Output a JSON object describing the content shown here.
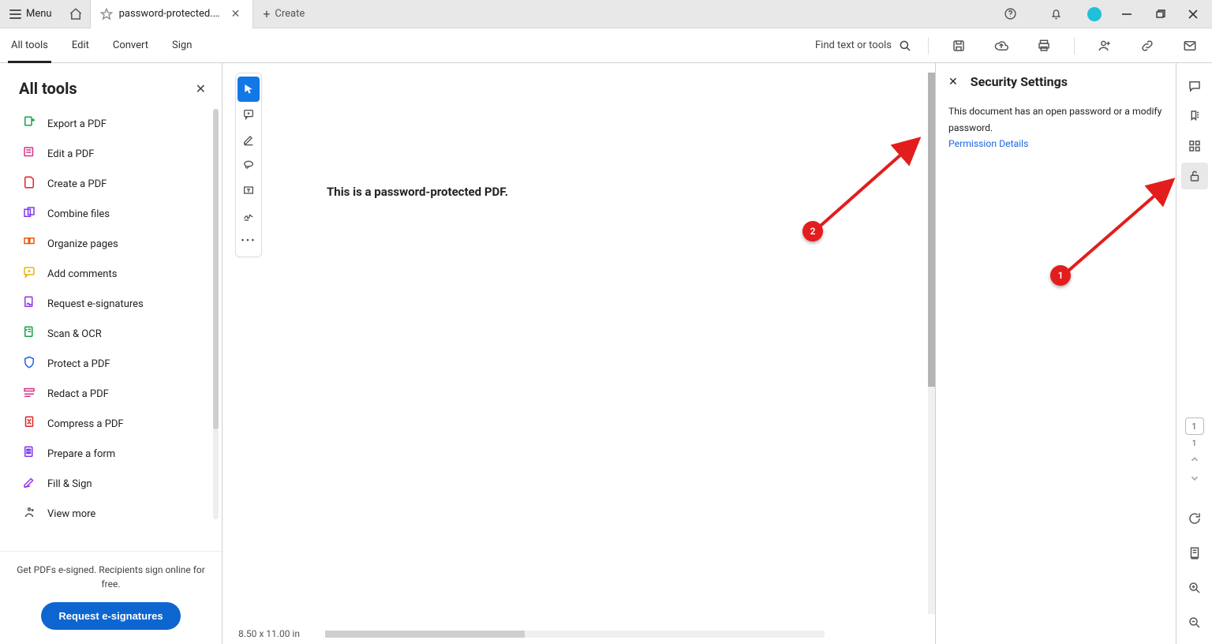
{
  "titlebar": {
    "menu_label": "Menu",
    "tab_title": "password-protected.pdf ...",
    "create_label": "Create"
  },
  "toolbar": {
    "all_tools": "All tools",
    "edit": "Edit",
    "convert": "Convert",
    "sign": "Sign",
    "find_placeholder": "Find text or tools"
  },
  "sidebar": {
    "title": "All tools",
    "items": [
      {
        "label": "Export a PDF",
        "icon": "export"
      },
      {
        "label": "Edit a PDF",
        "icon": "edit"
      },
      {
        "label": "Create a PDF",
        "icon": "create"
      },
      {
        "label": "Combine files",
        "icon": "combine"
      },
      {
        "label": "Organize pages",
        "icon": "organize"
      },
      {
        "label": "Add comments",
        "icon": "comments"
      },
      {
        "label": "Request e-signatures",
        "icon": "request-sign"
      },
      {
        "label": "Scan & OCR",
        "icon": "scan"
      },
      {
        "label": "Protect a PDF",
        "icon": "protect"
      },
      {
        "label": "Redact a PDF",
        "icon": "redact"
      },
      {
        "label": "Compress a PDF",
        "icon": "compress"
      },
      {
        "label": "Prepare a form",
        "icon": "form"
      },
      {
        "label": "Fill & Sign",
        "icon": "fill-sign"
      },
      {
        "label": "View more",
        "icon": "more"
      }
    ],
    "footer_text": "Get PDFs e-signed. Recipients sign online for free.",
    "cta_label": "Request e-signatures"
  },
  "document": {
    "body_text": "This is a password-protected PDF.",
    "page_dimensions": "8.50 x 11.00 in"
  },
  "security": {
    "title": "Security Settings",
    "message": "This document has an open password or a modify password.",
    "link_label": "Permission Details"
  },
  "rail": {
    "current_page": "1",
    "total_label": "1"
  },
  "annotations": {
    "a1": "1",
    "a2": "2"
  }
}
